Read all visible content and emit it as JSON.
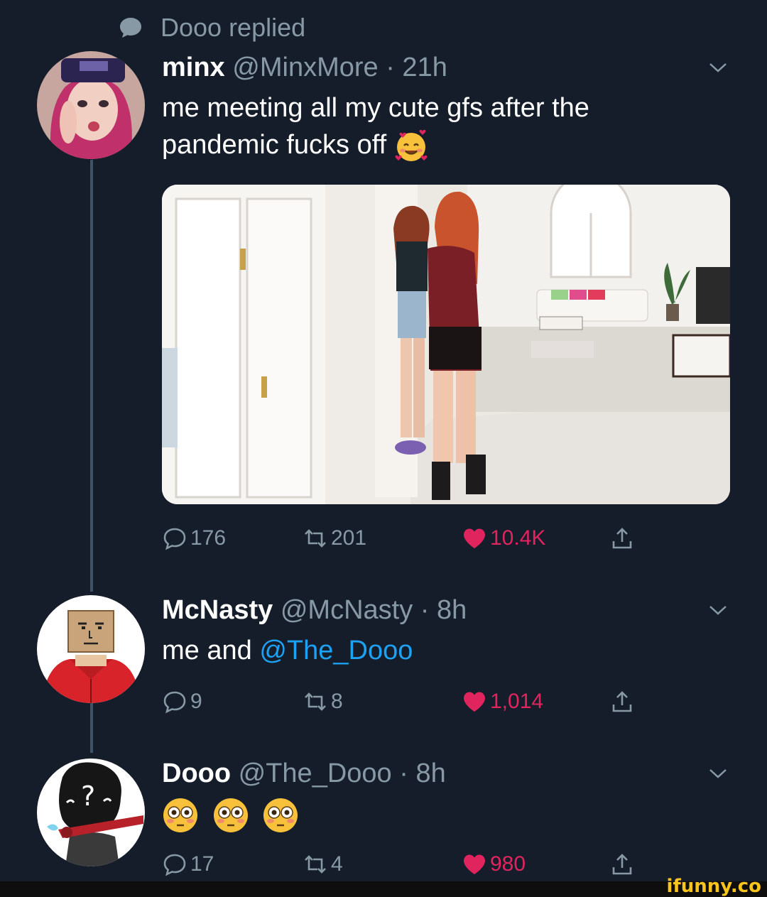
{
  "reply_context": {
    "icon": "speech-bubble-icon",
    "text": "Dooo replied"
  },
  "tweets": [
    {
      "name": "minx",
      "handle": "@MinxMore",
      "time": "· 21h",
      "text": "me meeting all my cute gfs after the pandemic fucks off",
      "emoji": "smiling-face-with-hearts",
      "media": "photo",
      "replies": "176",
      "retweets": "201",
      "likes": "10.4K"
    },
    {
      "name": "McNasty",
      "handle": "@McNasty",
      "time": "· 8h",
      "text": "me and ",
      "mention": "@The_Dooo",
      "replies": "9",
      "retweets": "8",
      "likes": "1,014"
    },
    {
      "name": "Dooo",
      "handle": "@The_Dooo",
      "time": "· 8h",
      "emoji": "flushed-face x3",
      "replies": "17",
      "retweets": "4",
      "likes": "980"
    }
  ],
  "watermark": "ifunny.co",
  "colors": {
    "background": "#151d2a",
    "secondary_text": "#8899a6",
    "like": "#e0245e",
    "mention": "#1da1f2"
  }
}
